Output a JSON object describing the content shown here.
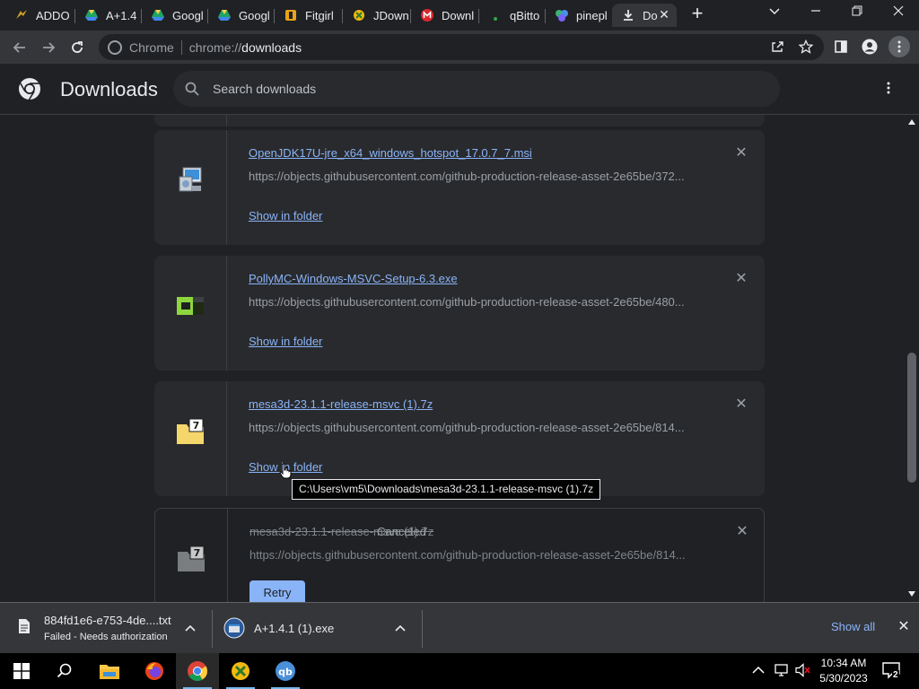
{
  "tabs": [
    {
      "title": "ADDO",
      "icon": "addon-icon"
    },
    {
      "title": "A+1.4",
      "icon": "drive-icon"
    },
    {
      "title": "Googl",
      "icon": "drive-icon"
    },
    {
      "title": "Googl",
      "icon": "drive-icon"
    },
    {
      "title": "Fitgirl",
      "icon": "fitgirl-icon"
    },
    {
      "title": "JDown",
      "icon": "jdownloader-icon"
    },
    {
      "title": "Downl",
      "icon": "mega-icon"
    },
    {
      "title": "qBitto",
      "icon": "qbittorrent-icon"
    },
    {
      "title": "pinepl",
      "icon": "pinepl-icon"
    },
    {
      "title": "Do",
      "icon": "download-icon",
      "active": true
    }
  ],
  "toolbar": {
    "site_chip": "Chrome",
    "url_scheme": "chrome://",
    "url_host": "downloads"
  },
  "page": {
    "title": "Downloads",
    "search_placeholder": "Search downloads"
  },
  "downloads": [
    {
      "filename": "OpenJDK17U-jre_x64_windows_hotspot_17.0.7_7.msi",
      "url": "https://objects.githubusercontent.com/github-production-release-asset-2e65be/372...",
      "action": "Show in folder",
      "icon": "msi-installer-icon"
    },
    {
      "filename": "PollyMC-Windows-MSVC-Setup-6.3.exe",
      "url": "https://objects.githubusercontent.com/github-production-release-asset-2e65be/480...",
      "action": "Show in folder",
      "icon": "pollymc-icon"
    },
    {
      "filename": "mesa3d-23.1.1-release-msvc (1).7z",
      "url": "https://objects.githubusercontent.com/github-production-release-asset-2e65be/814...",
      "action": "Show in folder",
      "icon": "7z-archive-icon"
    },
    {
      "filename": "mesa3d-23.1.1-release-msvc (1).7z",
      "status": "Canceled",
      "url": "https://objects.githubusercontent.com/github-production-release-asset-2e65be/814...",
      "action": "Retry",
      "icon": "7z-archive-icon"
    }
  ],
  "tooltip": "C:\\Users\\vm5\\Downloads\\mesa3d-23.1.1-release-msvc (1).7z",
  "shelf": {
    "items": [
      {
        "name": "884fd1e6-e753-4de....txt",
        "status": "Failed - Needs authorization"
      },
      {
        "name": "A+1.4.1 (1).exe",
        "status": ""
      }
    ],
    "show_all": "Show all"
  },
  "taskbar": {
    "time": "10:34 AM",
    "date": "5/30/2023",
    "notification_count": "2"
  },
  "colors": {
    "accent": "#8ab4f8",
    "background": "#202124",
    "card": "#292a2d"
  }
}
